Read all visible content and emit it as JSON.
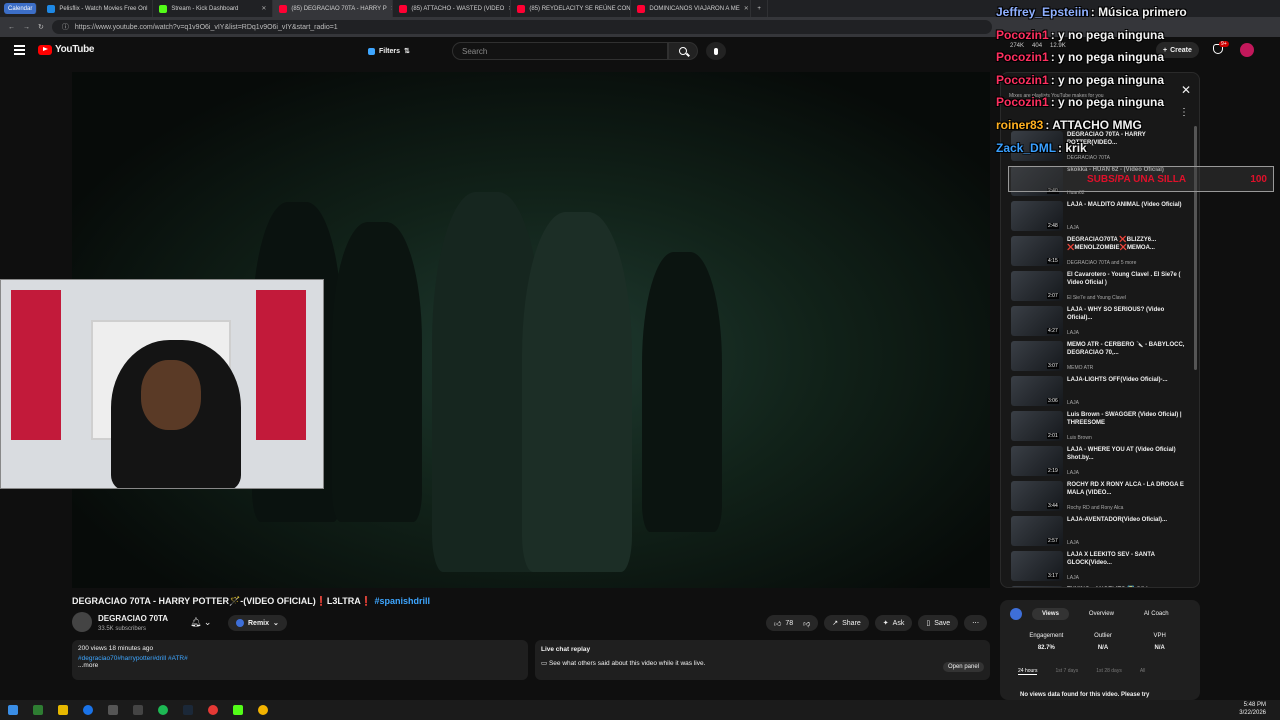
{
  "browser": {
    "tabs": [
      {
        "label": "Calendar",
        "type": "cal"
      },
      {
        "label": "Pelisflix - Watch Movies Free Onl",
        "type": "tab"
      },
      {
        "label": "Stream - Kick Dashboard",
        "type": "tab"
      },
      {
        "label": "(85) DEGRACIAO 70TA - HARRY P",
        "type": "active"
      },
      {
        "label": "(85) ATTACHO - WASTED (VIDEO",
        "type": "tab"
      },
      {
        "label": "(85) REYDELACITY SE REÚNE CON",
        "type": "tab"
      },
      {
        "label": "DOMINICANOS VIAJARON A ME",
        "type": "tab"
      }
    ],
    "url": "https://www.youtube.com/watch?v=q1v9O6i_vIY&list=RDq1v9O6i_vIY&start_radio=1"
  },
  "youtube": {
    "logo": "YouTube",
    "filters_label": "Filters",
    "search_placeholder": "Search",
    "create_label": "Create",
    "notif_badge": "9+"
  },
  "chat": [
    {
      "user": "Jeffrey_Epsteiin",
      "msg": "Música primero",
      "color": "#8fb0ff"
    },
    {
      "user": "Pocozin1",
      "msg": "y no pega ninguna",
      "color": "#ff3060"
    },
    {
      "user": "Pocozin1",
      "msg": "y no pega ninguna",
      "color": "#ff3060"
    },
    {
      "user": "Pocozin1",
      "msg": "y no pega ninguna",
      "color": "#ff3060"
    },
    {
      "user": "Pocozin1",
      "msg": "y no pega ninguna",
      "color": "#ff3060"
    },
    {
      "user": "roiner83",
      "msg": "ATTACHO MMG",
      "color": "#ffb020"
    },
    {
      "user": "Zack_DML",
      "msg": "krik",
      "color": "#3aa0ff"
    }
  ],
  "subs_banner": {
    "text": "SUBS/PA UNA SILLA",
    "count": "100"
  },
  "topstats": [
    "274K",
    "404",
    "12.9K"
  ],
  "playlist": {
    "subtitle": "Mixes are playlists YouTube makes for you",
    "items": [
      {
        "title": "DEGRACIAO 70TA - HARRY POTTER(VIDEO...",
        "channel": "DEGRACIAO 70TA",
        "duration": ""
      },
      {
        "title": "skokka - HUAN 62 - (Video Oficial)",
        "channel": "Huan62",
        "duration": "2:40"
      },
      {
        "title": "LAJA - MALDITO ANIMAL (Video Oficial)",
        "channel": "LAJA",
        "duration": "2:48"
      },
      {
        "title": "DEGRACIAO70TA ❌BLIZZY6... ❌MENOLZOMBIE❌MEMOA...",
        "channel": "DEGRACIAO 70TA and 5 more",
        "duration": "4:15"
      },
      {
        "title": "El Cavarotero - Young Clavel . El Sie7e ( Video Oficial )",
        "channel": "El Sie7e and Young Clavel",
        "duration": "2:07"
      },
      {
        "title": "LAJA - WHY SO SERIOUS? (Video Oficial)...",
        "channel": "LAJA",
        "duration": "4:27"
      },
      {
        "title": "MEMO ATR - CERBERO 🔪 - BABYLOCC, DEGRACIAO 70,...",
        "channel": "MEMO ATR",
        "duration": "3:07"
      },
      {
        "title": "LAJA-LIGHTS OFF(Video Oficial)-...",
        "channel": "LAJA",
        "duration": "3:06"
      },
      {
        "title": "Luis Brown - SWAGGER (Video Oficial) | THREESOME",
        "channel": "Luis Brown",
        "duration": "2:01"
      },
      {
        "title": "LAJA - WHERE YOU AT (Video Oficial) Shot.by...",
        "channel": "LAJA",
        "duration": "2:19"
      },
      {
        "title": "ROCHY RD X RONY ALCA - LA DROGA E MALA (VIDEO...",
        "channel": "Rochy RD and Rony Alca",
        "duration": "3:44"
      },
      {
        "title": "LAJA-AVENTADOR(Video Oficial)...",
        "channel": "LAJA",
        "duration": "2:57"
      },
      {
        "title": "LAJA X LEEKITO SEV - SANTA GLOCK(Video...",
        "channel": "LAJA",
        "duration": "3:17"
      },
      {
        "title": "TYKING - ANGELITO 😇 (Video",
        "channel": "",
        "duration": ""
      }
    ]
  },
  "video": {
    "title_main": "DEGRACIAO 70TA - HARRY POTTER🪄-(VIDEO OFICIAL)❗L3LTRA❗",
    "title_tag": "#spanishdrill",
    "channel": "DEGRACIAO 70TA",
    "subscribers": "33.5K subscribers",
    "remix": "Remix",
    "likes": "78",
    "share": "Share",
    "ask": "Ask",
    "save": "Save",
    "desc_meta": "200 views  18 minutes ago",
    "desc_tags": "#degraciao70#harrypotter#drill #ATR#",
    "desc_more": "...more",
    "livechat_title": "Live chat replay",
    "livechat_text": "See what others said about this video while it was live.",
    "open_panel": "Open panel"
  },
  "analytics": {
    "tabs": [
      "Views",
      "Overview",
      "AI Coach"
    ],
    "labels": [
      "Engagement",
      "Outlier",
      "VPH"
    ],
    "values": [
      "82.7%",
      "N/A",
      "N/A"
    ],
    "periods": [
      "24 hours",
      "1st 7 days",
      "1st 28 days",
      "All"
    ],
    "message": "No views data found for this video. Please try"
  },
  "clock": {
    "time": "5:48 PM",
    "date": "3/22/2026"
  }
}
